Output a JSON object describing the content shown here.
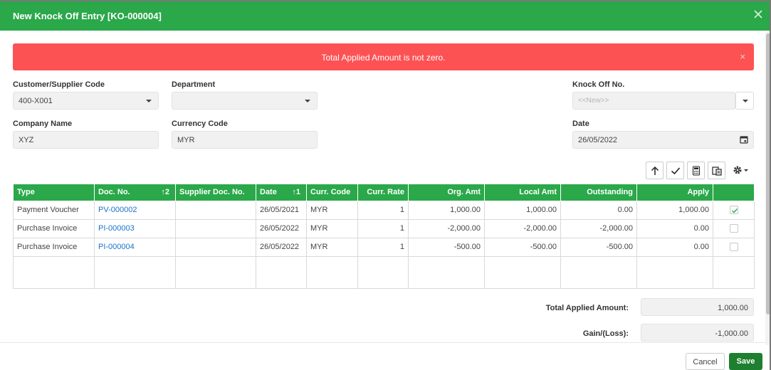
{
  "dialog": {
    "title": "New Knock Off Entry [KO-000004]"
  },
  "alert": {
    "message": "Total Applied Amount is not zero.",
    "close": "×"
  },
  "form": {
    "customer_code": {
      "label": "Customer/Supplier Code",
      "value": "400-X001"
    },
    "department": {
      "label": "Department",
      "value": ""
    },
    "knock_off_no": {
      "label": "Knock Off No.",
      "placeholder": "<<New>>"
    },
    "company_name": {
      "label": "Company Name",
      "value": "XYZ"
    },
    "currency_code": {
      "label": "Currency Code",
      "value": "MYR"
    },
    "date": {
      "label": "Date",
      "value": "26/05/2022"
    }
  },
  "toolbar": {
    "icons": [
      "arrow-up-icon",
      "check-icon",
      "calculator-icon",
      "copy-icon",
      "gear-icon"
    ]
  },
  "table": {
    "headers": {
      "type": "Type",
      "doc_no": "Doc. No.",
      "doc_no_sort": "2",
      "supplier_doc_no": "Supplier Doc. No.",
      "date": "Date",
      "date_sort": "1",
      "curr_code": "Curr. Code",
      "curr_rate": "Curr. Rate",
      "org_amt": "Org. Amt",
      "local_amt": "Local Amt",
      "outstanding": "Outstanding",
      "apply": "Apply"
    },
    "rows": [
      {
        "type": "Payment Voucher",
        "doc_no": "PV-000002",
        "supplier_doc_no": "",
        "date": "26/05/2021",
        "curr_code": "MYR",
        "curr_rate": "1",
        "org_amt": "1,000.00",
        "local_amt": "1,000.00",
        "outstanding": "0.00",
        "apply": "1,000.00",
        "checked": true
      },
      {
        "type": "Purchase Invoice",
        "doc_no": "PI-000003",
        "supplier_doc_no": "",
        "date": "26/05/2022",
        "curr_code": "MYR",
        "curr_rate": "1",
        "org_amt": "-2,000.00",
        "local_amt": "-2,000.00",
        "outstanding": "-2,000.00",
        "apply": "0.00",
        "checked": false
      },
      {
        "type": "Purchase Invoice",
        "doc_no": "PI-000004",
        "supplier_doc_no": "",
        "date": "26/05/2022",
        "curr_code": "MYR",
        "curr_rate": "1",
        "org_amt": "-500.00",
        "local_amt": "-500.00",
        "outstanding": "-500.00",
        "apply": "0.00",
        "checked": false
      }
    ]
  },
  "totals": {
    "applied_label": "Total Applied Amount:",
    "applied_value": "1,000.00",
    "gain_label": "Gain/(Loss):",
    "gain_value": "-1,000.00"
  },
  "buttons": {
    "cancel": "Cancel",
    "save": "Save"
  },
  "colors": {
    "header": "#2aa84a",
    "alert": "#fd5254",
    "save": "#1d7f2f",
    "link": "#1a73c8"
  }
}
